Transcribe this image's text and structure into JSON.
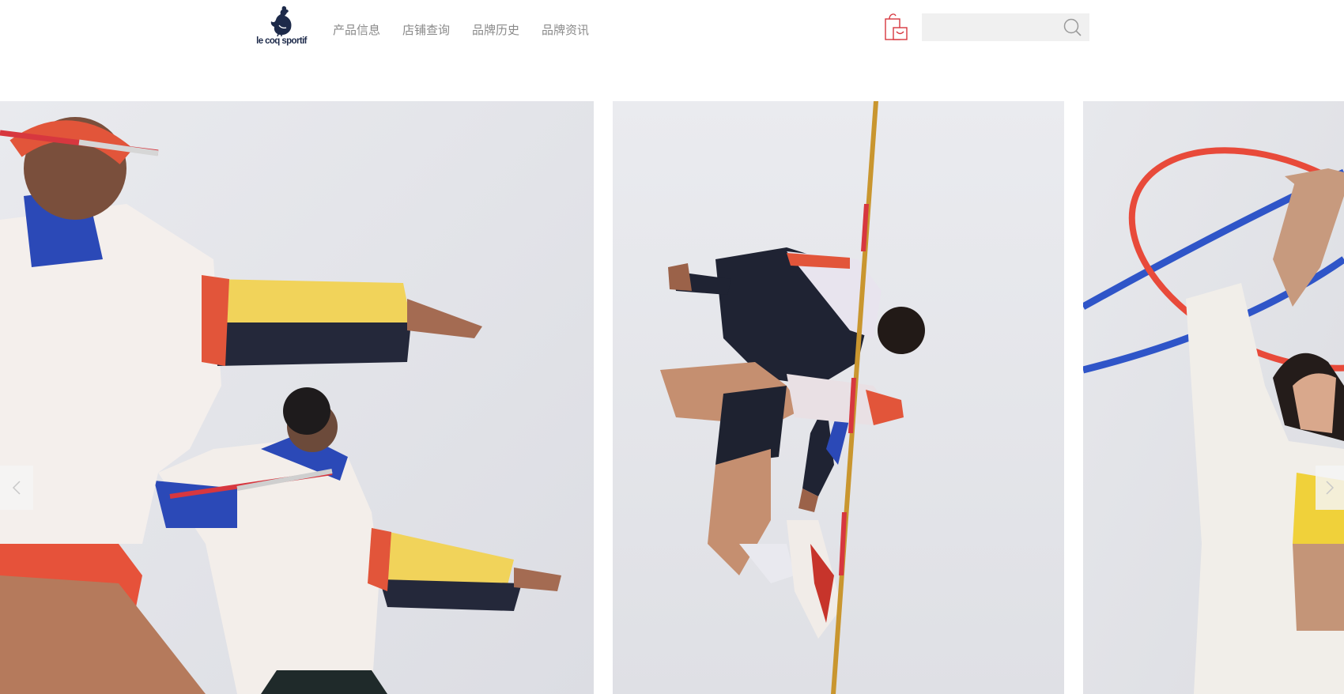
{
  "header": {
    "logo_text": "le coq sportif",
    "nav": [
      {
        "label": "产品信息"
      },
      {
        "label": "店铺查询"
      },
      {
        "label": "品牌历史"
      },
      {
        "label": "品牌资讯"
      }
    ],
    "search": {
      "value": "",
      "placeholder": ""
    },
    "icons": {
      "cart": "shopping-bag-icon",
      "search": "search-icon"
    }
  },
  "carousel": {
    "slides": [
      {
        "subject": "athletes-with-javelins"
      },
      {
        "subject": "high-jumper-with-pole"
      },
      {
        "subject": "athlete-with-hoops"
      }
    ],
    "prev_icon": "chevron-left-icon",
    "next_icon": "chevron-right-icon"
  },
  "colors": {
    "accent_red": "#d7373f",
    "logo_navy": "#1d2a4a",
    "nav_text": "#8a8a8a",
    "search_bg": "#f0f0f0"
  }
}
